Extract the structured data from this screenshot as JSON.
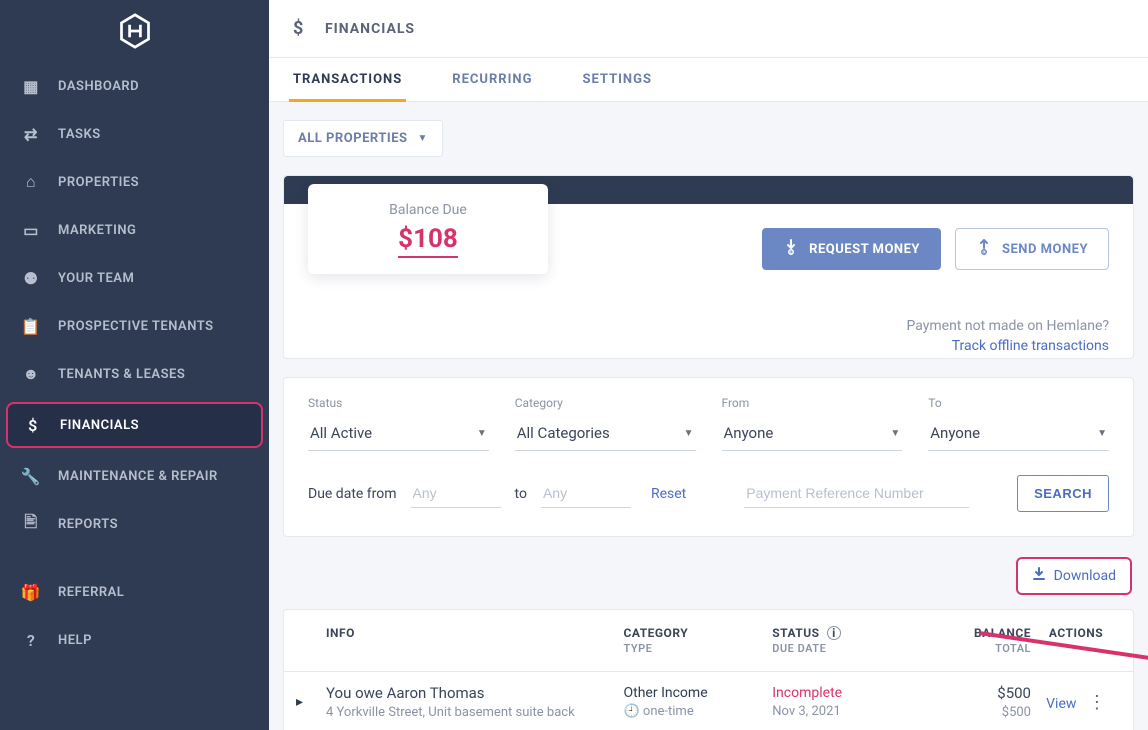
{
  "sidebar": {
    "items": [
      {
        "label": "DASHBOARD",
        "icon": "▦"
      },
      {
        "label": "TASKS",
        "icon": "⇄"
      },
      {
        "label": "PROPERTIES",
        "icon": "⌂"
      },
      {
        "label": "MARKETING",
        "icon": "▭"
      },
      {
        "label": "YOUR TEAM",
        "icon": "⚉"
      },
      {
        "label": "PROSPECTIVE TENANTS",
        "icon": "📋"
      },
      {
        "label": "TENANTS & LEASES",
        "icon": "☻"
      },
      {
        "label": "FINANCIALS",
        "icon": "$",
        "active": true
      },
      {
        "label": "MAINTENANCE & REPAIR",
        "icon": "🔧"
      },
      {
        "label": "REPORTS",
        "icon": "🖹"
      }
    ],
    "bottom": [
      {
        "label": "REFERRAL",
        "icon": "🎁"
      },
      {
        "label": "HELP",
        "icon": "?"
      }
    ]
  },
  "page": {
    "title": "FINANCIALS",
    "tabs": [
      "TRANSACTIONS",
      "RECURRING",
      "SETTINGS"
    ],
    "activeTab": 0,
    "propertiesFilter": "ALL PROPERTIES"
  },
  "balance": {
    "label": "Balance Due",
    "amount": "$108"
  },
  "buttons": {
    "request": "REQUEST MONEY",
    "send": "SEND MONEY",
    "offlineNote": "Payment not made on Hemlane?",
    "offlineLink": "Track offline transactions",
    "download": "Download",
    "search": "SEARCH",
    "reset": "Reset"
  },
  "filters": {
    "status": {
      "label": "Status",
      "value": "All Active"
    },
    "category": {
      "label": "Category",
      "value": "All Categories"
    },
    "from": {
      "label": "From",
      "value": "Anyone"
    },
    "to": {
      "label": "To",
      "value": "Anyone"
    },
    "dueFromLabel": "Due date from",
    "duePlaceholder": "Any",
    "toLabel": "to",
    "refPlaceholder": "Payment Reference Number"
  },
  "tableHead": {
    "info": "INFO",
    "category": "CATEGORY",
    "categorySub": "TYPE",
    "status": "STATUS",
    "statusSub": "DUE DATE",
    "balance": "BALANCE",
    "balanceSub": "TOTAL",
    "actions": "ACTIONS"
  },
  "rows": [
    {
      "title": "You owe Aaron Thomas",
      "subtitle": "4 Yorkville Street, Unit basement suite back",
      "category": "Other Income",
      "type": "one-time",
      "status": "Incomplete",
      "dueDate": "Nov 3, 2021",
      "balance": "$500",
      "total": "$500",
      "action": "View"
    }
  ]
}
